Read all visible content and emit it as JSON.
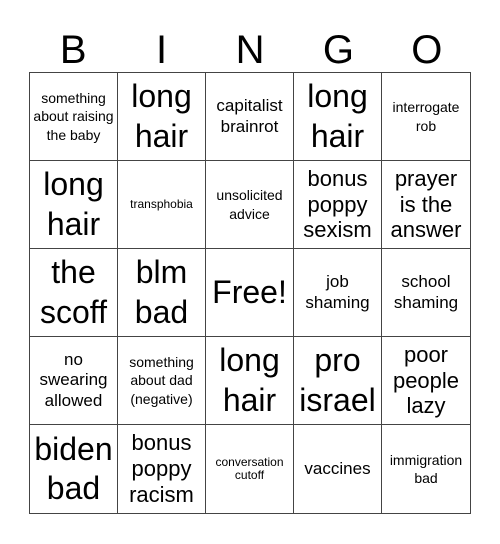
{
  "header": [
    "B",
    "I",
    "N",
    "G",
    "O"
  ],
  "cells": [
    {
      "text": "something about raising the baby",
      "size": "s-sm"
    },
    {
      "text": "long hair",
      "size": "s-xl"
    },
    {
      "text": "capitalist brainrot",
      "size": "s-md"
    },
    {
      "text": "long hair",
      "size": "s-xl"
    },
    {
      "text": "interrogate rob",
      "size": "s-sm"
    },
    {
      "text": "long hair",
      "size": "s-xl"
    },
    {
      "text": "transphobia",
      "size": "s-xs"
    },
    {
      "text": "unsolicited advice",
      "size": "s-sm"
    },
    {
      "text": "bonus poppy sexism",
      "size": "s-lg"
    },
    {
      "text": "prayer is the answer",
      "size": "s-lg"
    },
    {
      "text": "the scoff",
      "size": "s-xl"
    },
    {
      "text": "blm bad",
      "size": "s-xl"
    },
    {
      "text": "Free!",
      "size": "s-xl"
    },
    {
      "text": "job shaming",
      "size": "s-md"
    },
    {
      "text": "school shaming",
      "size": "s-md"
    },
    {
      "text": "no swearing allowed",
      "size": "s-md"
    },
    {
      "text": "something about dad (negative)",
      "size": "s-sm"
    },
    {
      "text": "long hair",
      "size": "s-xl"
    },
    {
      "text": "pro israel",
      "size": "s-xl"
    },
    {
      "text": "poor people lazy",
      "size": "s-lg"
    },
    {
      "text": "biden bad",
      "size": "s-xl"
    },
    {
      "text": "bonus poppy racism",
      "size": "s-lg"
    },
    {
      "text": "conversation cutoff",
      "size": "s-xs"
    },
    {
      "text": "vaccines",
      "size": "s-md"
    },
    {
      "text": "immigration bad",
      "size": "s-sm"
    }
  ]
}
